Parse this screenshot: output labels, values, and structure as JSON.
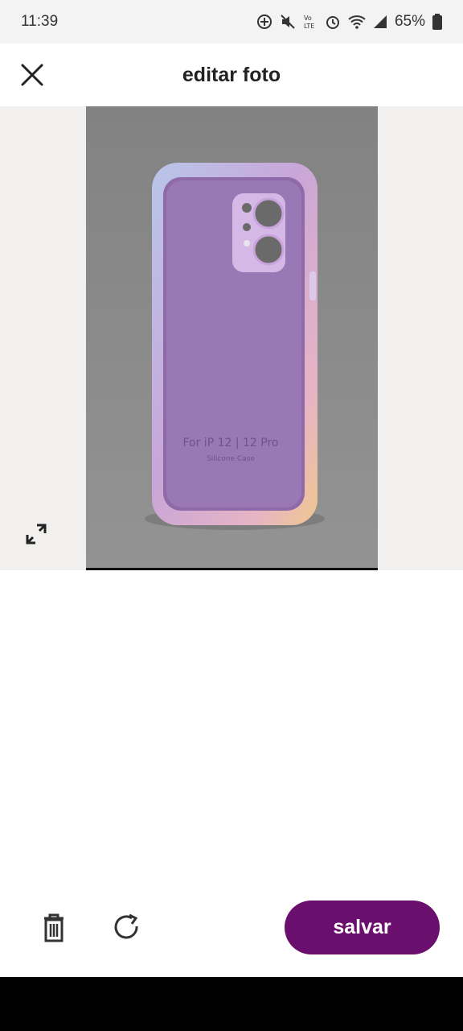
{
  "status_bar": {
    "time": "11:39",
    "icons": [
      "data-saver-icon",
      "mute-icon",
      "volte-icon",
      "alarm-icon",
      "wifi-icon",
      "signal-icon",
      "battery-icon"
    ],
    "volte_label": "Vo LTE",
    "battery": "65%"
  },
  "header": {
    "title": "editar foto",
    "close_icon": "close-icon"
  },
  "photo": {
    "case_text_line1": "For iP 12 | 12 Pro",
    "case_text_line2": "Silicone Case",
    "colors": {
      "background": "#8a8a8a",
      "case": "#9b7cb6"
    }
  },
  "canvas": {
    "resize_icon": "resize-icon"
  },
  "actions": {
    "delete_icon": "trash-icon",
    "rotate_icon": "rotate-icon",
    "save_label": "salvar"
  },
  "theme": {
    "accent": "#6b0f6e"
  }
}
